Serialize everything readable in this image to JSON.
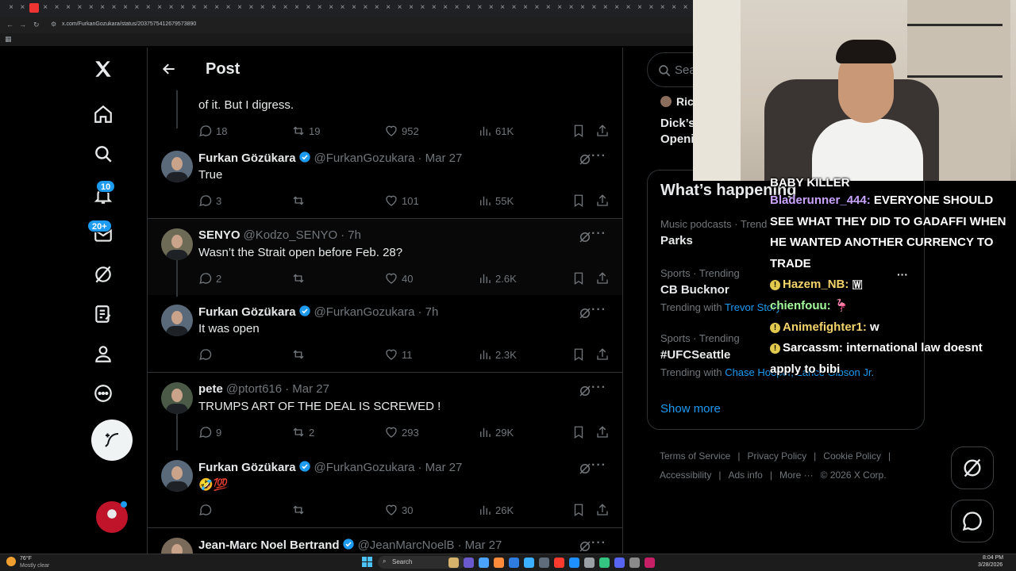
{
  "browser": {
    "url": "x.com/FurkanGozukara/status/2037575412679573890",
    "tab_close": "×"
  },
  "nav": {
    "notifications_badge": "10",
    "messages_badge": "20+"
  },
  "header": {
    "title": "Post"
  },
  "posts": [
    {
      "id": "p0",
      "text": "of it. But I digress.",
      "replies": "18",
      "reposts": "19",
      "likes": "952",
      "views": "61K"
    },
    {
      "id": "p1",
      "name": "Furkan Gözükara",
      "handle": "@FurkanGozukara",
      "time": "· Mar 27",
      "verified": true,
      "text": "True",
      "replies": "3",
      "reposts": "",
      "likes": "101",
      "views": "55K"
    },
    {
      "id": "p2",
      "name": "SENYO",
      "handle": "@Kodzo_SENYO",
      "time": "· 7h",
      "verified": false,
      "text": "Wasn’t the Strait open before Feb. 28?",
      "replies": "2",
      "reposts": "",
      "likes": "40",
      "views": "2.6K"
    },
    {
      "id": "p3",
      "name": "Furkan Gözükara",
      "handle": "@FurkanGozukara",
      "time": "· 7h",
      "verified": true,
      "text": "It was open",
      "replies": "",
      "reposts": "",
      "likes": "11",
      "views": "2.3K"
    },
    {
      "id": "p4",
      "name": "pete",
      "handle": "@ptort616",
      "time": "· Mar 27",
      "verified": false,
      "text": "TRUMPS ART OF THE DEAL IS SCREWED !",
      "replies": "9",
      "reposts": "2",
      "likes": "293",
      "views": "29K"
    },
    {
      "id": "p5",
      "name": "Furkan Gözükara",
      "handle": "@FurkanGozukara",
      "time": "· Mar 27",
      "verified": true,
      "text": "🤣💯",
      "replies": "",
      "reposts": "",
      "likes": "30",
      "views": "26K"
    },
    {
      "id": "p6",
      "name": "Jean-Marc Noel Bertrand",
      "handle": "@JeanMarcNoelB",
      "time": "· Mar 27",
      "verified": true,
      "text": ""
    }
  ],
  "right": {
    "search_placeholder": "Sea",
    "news_author": "Ric",
    "news_title_1": "Dick’s",
    "news_title_2": "Openi",
    "happening_title": "What’s happening",
    "trends": [
      {
        "meta": "Music podcasts · Trend",
        "title": "Parks",
        "sub_prefix": "",
        "sub_links": ""
      },
      {
        "meta": "Sports · Trending",
        "title": "CB Bucknor",
        "sub_prefix": "Trending with",
        "sub_links": "Trevor Story"
      },
      {
        "meta": "Sports · Trending",
        "title": "#UFCSeattle",
        "sub_prefix": "Trending with",
        "sub_links": "Chase Hooper, Lance Gibson Jr."
      }
    ],
    "show_more": "Show more",
    "footer": [
      "Terms of Service",
      "|",
      "Privacy Policy",
      "|",
      "Cookie Policy",
      "|",
      "Accessibility",
      "|",
      "Ads info",
      "|",
      "More ···",
      "© 2026 X Corp."
    ]
  },
  "chat": {
    "top_fragment": "BABY KILLER",
    "messages": [
      {
        "user": "Bladerunner_444:",
        "text": "EVERYONE SHOULD SEE WHAT THEY DID TO GADAFFI WHEN HE WANTED ANOTHER CURRENCY TO TRADE",
        "color": "#c9a3ff"
      },
      {
        "user": "Hazem_NB:",
        "text": "🇼",
        "color": "#f3d36b"
      },
      {
        "user": "chienfouu:",
        "text": "🦩",
        "color": "#a6ff9e"
      },
      {
        "user": "Animefighter1:",
        "text": "w",
        "color": "#f3d36b"
      },
      {
        "user": "Sarcassm:",
        "text": "international law doesnt apply to bibi",
        "color": "#ffffff"
      }
    ]
  },
  "taskbar": {
    "weather_temp": "76°F",
    "weather_desc": "Mostly clear",
    "search": "Search",
    "time": "8:04 PM",
    "date": "3/28/2026"
  },
  "colors": {
    "accent": "#1d9bf0",
    "bg": "#000000",
    "muted": "#71767b",
    "border": "#2f3336"
  }
}
